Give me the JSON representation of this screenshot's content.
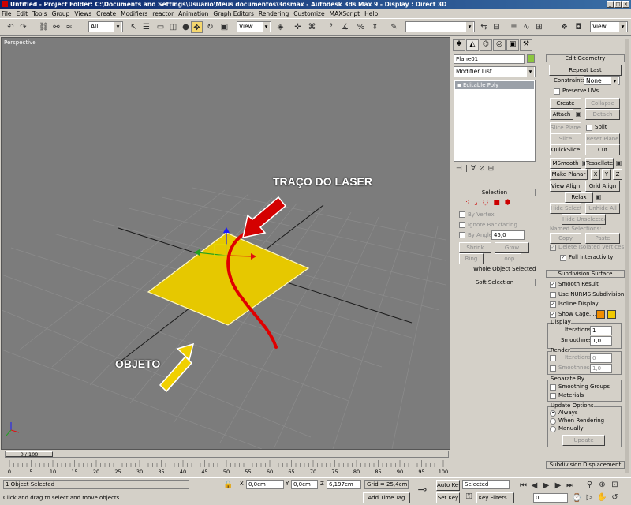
{
  "window": {
    "title": "Untitled   - Project Folder: C:\\Documents and Settings\\Usuário\\Meus documentos\\3dsmax   - Autodesk 3ds Max 9   - Display : Direct 3D",
    "min": "_",
    "max": "□",
    "close": "×"
  },
  "menu": [
    "File",
    "Edit",
    "Tools",
    "Group",
    "Views",
    "Create",
    "Modifiers",
    "reactor",
    "Animation",
    "Graph Editors",
    "Rendering",
    "Customize",
    "MAXScript",
    "Help"
  ],
  "toolbar": {
    "filter": "All",
    "ref_coord": "View",
    "named_sel": "",
    "view_right": "View"
  },
  "viewport": {
    "label": "Perspective",
    "annotation_laser": "TRAÇO DO LASER",
    "annotation_object": "OBJETO"
  },
  "timeline": {
    "frame": "0 / 100",
    "ticks": [
      "0",
      "5",
      "10",
      "15",
      "20",
      "25",
      "30",
      "35",
      "40",
      "45",
      "50",
      "55",
      "60",
      "65",
      "70",
      "75",
      "80",
      "85",
      "90",
      "95",
      "100"
    ]
  },
  "status": {
    "selected": "1 Object Selected",
    "prompt": "Click and drag to select and move objects",
    "x_label": "X",
    "x": "0,0cm",
    "y_label": "Y",
    "y": "0,0cm",
    "z_label": "Z",
    "z": "6,197cm",
    "grid": "Grid = 25,4cm",
    "add_time_tag": "Add Time Tag",
    "auto_key": "Auto Key",
    "set_key": "Set Key",
    "key_sel": "Selected",
    "key_filters": "Key Filters...",
    "frame_field": "0"
  },
  "cmd_panel": {
    "object_name": "Plane01",
    "object_color": "#8cc63f",
    "modifier_list": "Modifier List",
    "stack_item": "Editable Poly",
    "selection": {
      "title": "Selection",
      "by_vertex": "By Vertex",
      "ignore_backfacing": "Ignore Backfacing",
      "by_angle": "By Angle:",
      "angle": "45,0",
      "shrink": "Shrink",
      "grow": "Grow",
      "ring": "Ring",
      "loop": "Loop",
      "status": "Whole Object Selected"
    },
    "soft_selection": "Soft Selection"
  },
  "edit_geometry": {
    "title": "Edit Geometry",
    "repeat_last": "Repeat Last",
    "constraints": "Constraints:",
    "constraints_val": "None",
    "preserve_uvs": "Preserve UVs",
    "create": "Create",
    "collapse": "Collapse",
    "attach": "Attach",
    "detach": "Detach",
    "slice_plane": "Slice Plane",
    "split": "Split",
    "slice": "Slice",
    "reset_plane": "Reset Plane",
    "quickslice": "QuickSlice",
    "cut": "Cut",
    "msmooth": "MSmooth",
    "tessellate": "Tessellate",
    "make_planar": "Make Planar",
    "x": "X",
    "y": "Y",
    "z": "Z",
    "view_align": "View Align",
    "grid_align": "Grid Align",
    "relax": "Relax",
    "hide_selected": "Hide Selected",
    "unhide_all": "Unhide All",
    "hide_unselected": "Hide Unselected",
    "named_selections": "Named Selections:",
    "copy": "Copy",
    "paste": "Paste",
    "delete_isolated": "Delete Isolated Vertices",
    "full_interactivity": "Full Interactivity"
  },
  "subdivision": {
    "title": "Subdivision Surface",
    "smooth_result": "Smooth Result",
    "use_nurms": "Use NURMS Subdivision",
    "isoline": "Isoline Display",
    "show_cage": "Show Cage......",
    "cage_color1": "#f08c00",
    "cage_color2": "#f0c800",
    "display": "Display",
    "iterations": "Iterations:",
    "iterations_val": "1",
    "smoothness": "Smoothness:",
    "smoothness_val": "1,0",
    "render": "Render",
    "r_iterations_val": "0",
    "r_smoothness_val": "1,0",
    "separate_by": "Separate By",
    "smoothing_groups": "Smoothing Groups",
    "materials": "Materials",
    "update_options": "Update Options",
    "always": "Always",
    "when_rendering": "When Rendering",
    "manually": "Manually",
    "update": "Update"
  },
  "subdivision_displacement": "Subdivision Displacement"
}
